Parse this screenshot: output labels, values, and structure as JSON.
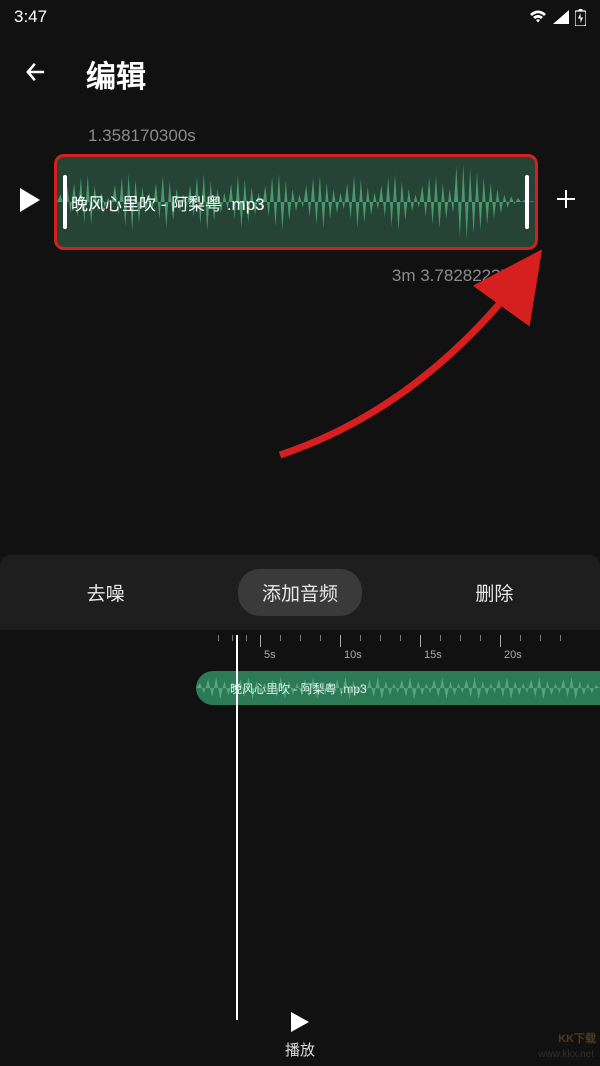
{
  "status": {
    "time": "3:47"
  },
  "header": {
    "title": "编辑"
  },
  "track": {
    "start_time": "1.358170300s",
    "name": "晚风心里吹 - 阿梨粤 .mp3",
    "end_time": "3m 3.782822370s"
  },
  "tabs": {
    "denoise": "去噪",
    "add_audio": "添加音频",
    "delete": "删除"
  },
  "timeline": {
    "ticks": [
      "5s",
      "10s",
      "15s",
      "20s"
    ],
    "track_name": "晚风心里吹 - 阿梨粤 .mp3"
  },
  "controls": {
    "play": "播放"
  },
  "watermark": {
    "url": "www.kkx.net",
    "logo": "KK下载"
  }
}
